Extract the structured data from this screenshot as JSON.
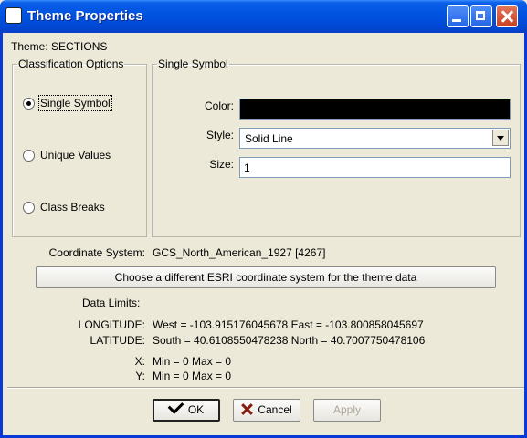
{
  "window": {
    "title": "Theme Properties"
  },
  "theme": {
    "label": "Theme: SECTIONS"
  },
  "classification": {
    "legend": "Classification Options",
    "options": [
      {
        "label": "Single Symbol",
        "selected": true
      },
      {
        "label": "Unique Values",
        "selected": false
      },
      {
        "label": "Class Breaks",
        "selected": false
      }
    ]
  },
  "single_symbol": {
    "legend": "Single Symbol",
    "color_label": "Color:",
    "color_value": "#000000",
    "style_label": "Style:",
    "style_value": "Solid Line",
    "size_label": "Size:",
    "size_value": "1"
  },
  "coordinate_system": {
    "label": "Coordinate System:",
    "value": "GCS_North_American_1927 [4267]",
    "choose_button": "Choose a different ESRI coordinate system for the theme data"
  },
  "data_limits": {
    "label": "Data Limits:",
    "longitude_label": "LONGITUDE:",
    "longitude_value": "West = -103.915176045678 East = -103.800858045697",
    "latitude_label": "LATITUDE:",
    "latitude_value": "South = 40.6108550478238 North = 40.7007750478106",
    "x_label": "X:",
    "x_value": "Min = 0 Max = 0",
    "y_label": "Y:",
    "y_value": "Min = 0 Max = 0"
  },
  "buttons": {
    "ok": "OK",
    "cancel": "Cancel",
    "apply": "Apply"
  },
  "icons": {
    "app": "app-icon",
    "ok": "check-icon",
    "cancel": "x-icon"
  }
}
